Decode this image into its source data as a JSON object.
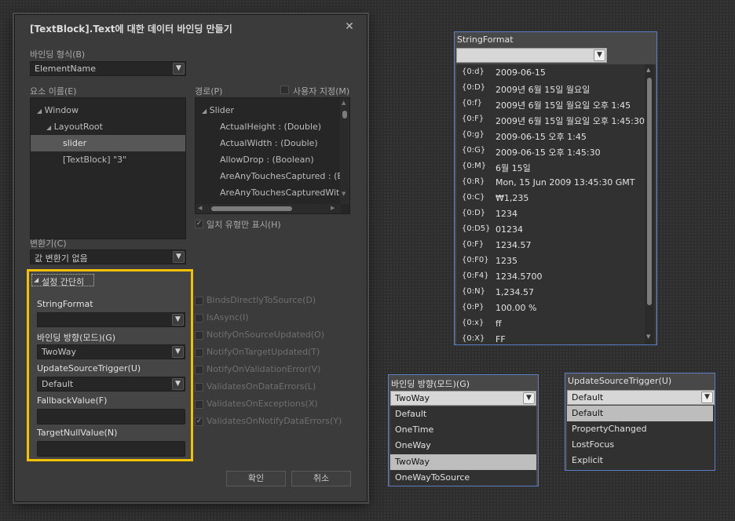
{
  "dialog": {
    "title": "[TextBlock].Text에 대한 데이터 바인딩 만들기",
    "binding_type_label": "바인딩 형식(B)",
    "binding_type_value": "ElementName",
    "element_name_label": "요소 이름(E)",
    "path_label": "경로(P)",
    "custom_label": "사용자 지정(M)",
    "elements": [
      "Window",
      "LayoutRoot",
      "slider",
      "[TextBlock] \"3\""
    ],
    "paths": [
      "Slider",
      "ActualHeight : (Double)",
      "ActualWidth : (Double)",
      "AllowDrop : (Boolean)",
      "AreAnyTouchesCaptured : (Bo",
      "AreAnyTouchesCapturedWithi"
    ],
    "match_type_label": "일치 유형만 표시(H)",
    "converter_label": "변환기(C)",
    "converter_value": "값 변환기 없음",
    "simple_settings_label": "설정 간단히",
    "string_format_label": "StringFormat",
    "string_format_value": "",
    "binding_direction_label": "바인딩 방향(모드)(G)",
    "binding_direction_value": "TwoWay",
    "update_trigger_label": "UpdateSourceTrigger(U)",
    "update_trigger_value": "Default",
    "fallback_label": "FallbackValue(F)",
    "fallback_value": "",
    "target_null_label": "TargetNullValue(N)",
    "target_null_value": "",
    "options": [
      {
        "label": "BindsDirectlyToSource(D)",
        "checked": false
      },
      {
        "label": "IsAsync(I)",
        "checked": false
      },
      {
        "label": "NotifyOnSourceUpdated(O)",
        "checked": false
      },
      {
        "label": "NotifyOnTargetUpdated(T)",
        "checked": false
      },
      {
        "label": "NotifyOnValidationError(V)",
        "checked": false
      },
      {
        "label": "ValidatesOnDataErrors(L)",
        "checked": false
      },
      {
        "label": "ValidatesOnExceptions(X)",
        "checked": false
      },
      {
        "label": "ValidatesOnNotifyDataErrors(Y)",
        "checked": true
      }
    ],
    "ok_label": "확인",
    "cancel_label": "취소"
  },
  "string_format_popup": {
    "title": "StringFormat",
    "items": [
      {
        "key": "{0:d}",
        "value": "2009-06-15"
      },
      {
        "key": "{0:D}",
        "value": "2009년 6월 15일 월요일"
      },
      {
        "key": "{0:f}",
        "value": "2009년 6월 15일 월요일 오후 1:45"
      },
      {
        "key": "{0:F}",
        "value": "2009년 6월 15일 월요일 오후 1:45:30"
      },
      {
        "key": "{0:g}",
        "value": "2009-06-15 오후 1:45"
      },
      {
        "key": "{0:G}",
        "value": "2009-06-15 오후 1:45:30"
      },
      {
        "key": "{0:M}",
        "value": "6월 15일"
      },
      {
        "key": "{0:R}",
        "value": "Mon, 15 Jun 2009 13:45:30 GMT"
      },
      {
        "key": "{0:C}",
        "value": "₩1,235"
      },
      {
        "key": "{0:D}",
        "value": "1234"
      },
      {
        "key": "{0:D5}",
        "value": "01234"
      },
      {
        "key": "{0:F}",
        "value": "1234.57"
      },
      {
        "key": "{0:F0}",
        "value": "1235"
      },
      {
        "key": "{0:F4}",
        "value": "1234.5700"
      },
      {
        "key": "{0:N}",
        "value": "1,234.57"
      },
      {
        "key": "{0:P}",
        "value": "100.00 %"
      },
      {
        "key": "{0:x}",
        "value": "ff"
      },
      {
        "key": "{0:X}",
        "value": "FF"
      }
    ]
  },
  "direction_popup": {
    "title": "바인딩 방향(모드)(G)",
    "value": "TwoWay",
    "options": [
      "Default",
      "OneTime",
      "OneWay",
      "TwoWay",
      "OneWayToSource"
    ],
    "selected": "TwoWay"
  },
  "trigger_popup": {
    "title": "UpdateSourceTrigger(U)",
    "value": "Default",
    "options": [
      "Default",
      "PropertyChanged",
      "LostFocus",
      "Explicit"
    ],
    "selected": "Default"
  },
  "colors": {
    "highlight_border": "#f2c200",
    "popup_border": "#5c7fc7",
    "selected_row": "#bdbdbd"
  }
}
